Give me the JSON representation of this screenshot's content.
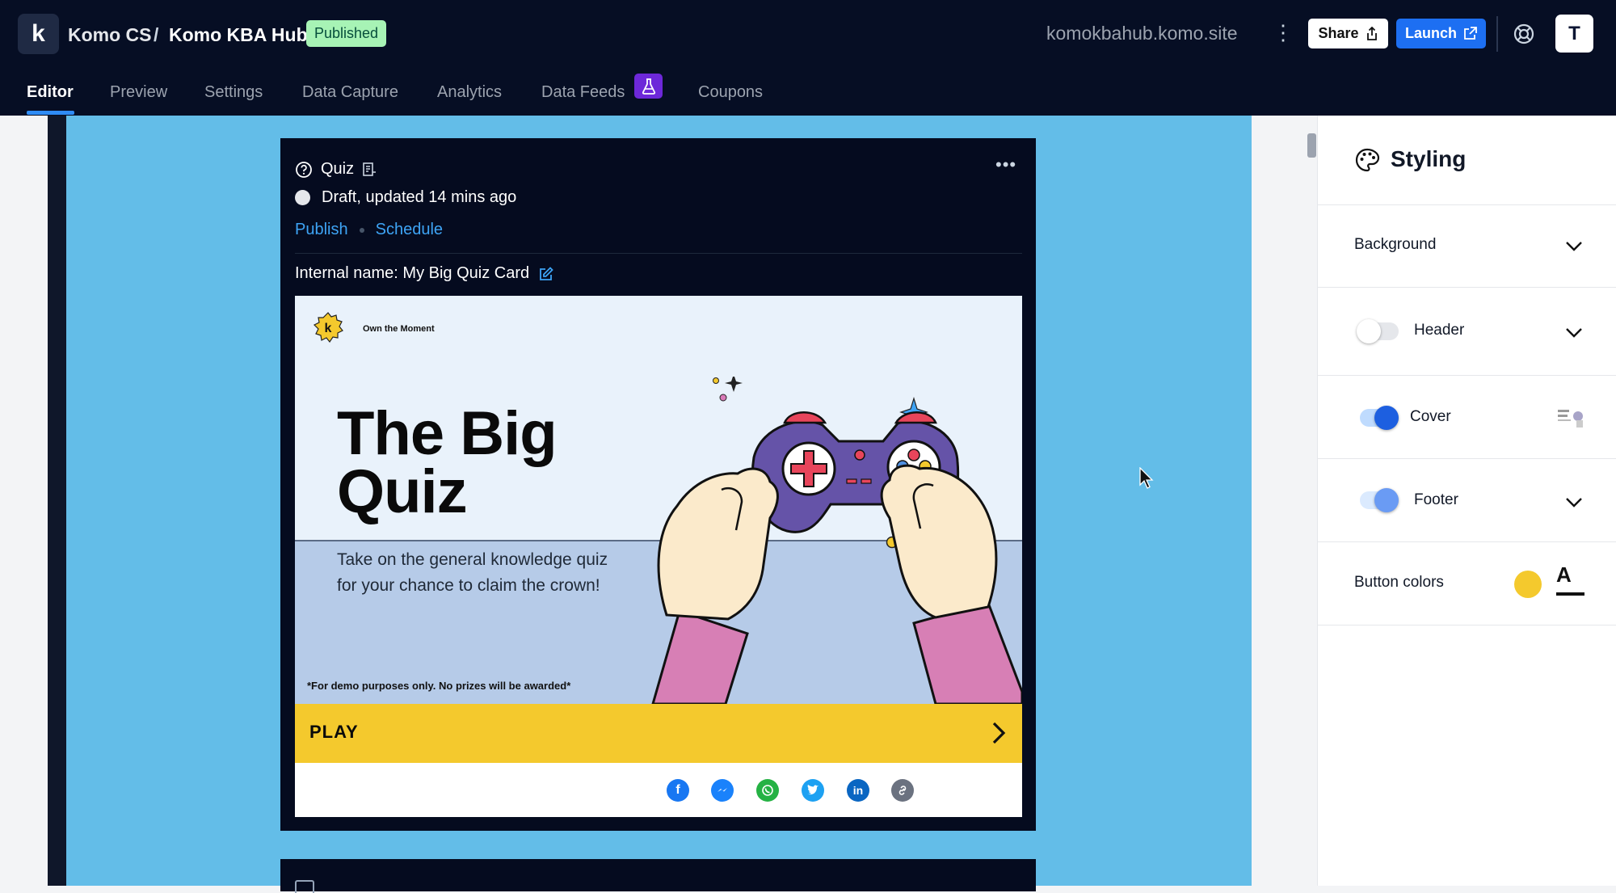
{
  "header": {
    "org": "Komo CS",
    "separator": "/",
    "hub": "Komo KBA Hub",
    "status_badge": "Published",
    "domain": "komokbahub.komo.site",
    "more_icon": "kebab-vertical-icon",
    "share_label": "Share",
    "launch_label": "Launch",
    "avatar_initial": "T",
    "logo_letter": "k"
  },
  "tabs": [
    "Editor",
    "Preview",
    "Settings",
    "Data Capture",
    "Analytics",
    "Data Feeds",
    "Coupons"
  ],
  "active_tab": "Editor",
  "card": {
    "type_label": "Quiz",
    "status": "Draft, updated 14 mins ago",
    "publish_link": "Publish",
    "schedule_link": "Schedule",
    "internal_name": "Internal name: My Big Quiz Card",
    "more": "•••",
    "cover": {
      "brand_tagline": "Own the Moment",
      "title_line1": "The Big",
      "title_line2": "Quiz",
      "description": "Take on the general knowledge quiz for your chance to claim the crown!",
      "disclaimer": "*For demo purposes only. No prizes will be awarded*"
    },
    "play_label": "PLAY",
    "share_icons": [
      "facebook-icon",
      "messenger-icon",
      "whatsapp-icon",
      "twitter-icon",
      "linkedin-icon",
      "link-icon"
    ]
  },
  "styling_panel": {
    "title": "Styling",
    "rows": {
      "background": "Background",
      "header": "Header",
      "cover": "Cover",
      "footer": "Footer",
      "button_colors": "Button colors"
    },
    "toggles": {
      "header": false,
      "cover": true,
      "footer": true
    },
    "button_text_swatch": "A"
  },
  "colors": {
    "topbar_bg": "#060e24",
    "accent_blue": "#1d6ff2",
    "published_green": "#a7f3b5",
    "page_bg": "#63bde8",
    "play_yellow": "#f4c92d",
    "data_feeds_purple": "#6d28d9"
  }
}
